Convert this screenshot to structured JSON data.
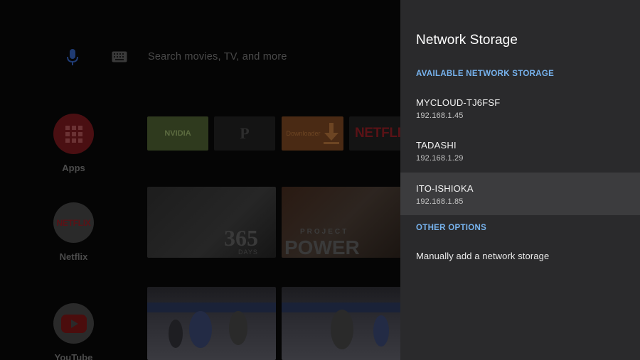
{
  "home": {
    "search_placeholder": "Search movies, TV, and more",
    "side_apps": [
      {
        "label": "Apps"
      },
      {
        "label": "Netflix",
        "logo": "NETFLIX"
      },
      {
        "label": "YouTube"
      }
    ],
    "tiles": [
      {
        "name": "NVIDIA",
        "color": "#2f3a1e"
      },
      {
        "name": "P",
        "color": "#141414"
      },
      {
        "name": "Downloader",
        "color": "#4a2a14"
      },
      {
        "name": "NETFLIX",
        "color": "#141414"
      }
    ],
    "posters": [
      {
        "title": "365",
        "subtitle": "DAYS"
      },
      {
        "title": "POWER",
        "subtitle": "PROJECT"
      }
    ]
  },
  "panel": {
    "title": "Network Storage",
    "available_header": "AVAILABLE NETWORK STORAGE",
    "devices": [
      {
        "name": "MYCLOUD-TJ6FSF",
        "ip": "192.168.1.45"
      },
      {
        "name": "TADASHI",
        "ip": "192.168.1.29"
      },
      {
        "name": "ITO-ISHIOKA",
        "ip": "192.168.1.85",
        "focused": true
      }
    ],
    "other_header": "OTHER OPTIONS",
    "manual_add": "Manually add a network storage"
  },
  "colors": {
    "panel_bg": "#2a2a2c",
    "focus_bg": "#3c3c3e",
    "accent": "#77b3ee",
    "apps_red": "#4a0f12",
    "youtube_red": "#4b0d0d"
  }
}
